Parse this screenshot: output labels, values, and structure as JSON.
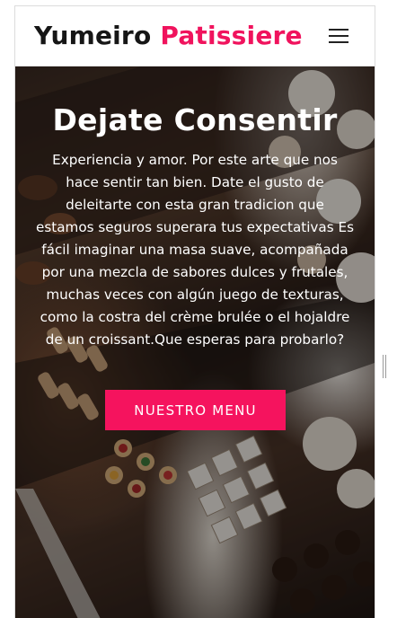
{
  "brand": {
    "part1": "Yumeiro",
    "part2": "Patissiere"
  },
  "nav": {
    "menu_icon": "hamburger-menu-icon"
  },
  "hero": {
    "title": "Dejate Consentir",
    "text": "Experiencia y amor. Por este arte que nos hace sentir tan bien. Date el gusto de deleitarte con esta gran tradicion que estamos seguros superara tus expectativas Es fácil imaginar una masa suave, acompañada por una mezcla de sabores dulces y frutales, muchas veces con algún juego de texturas, como la costra del crème brulée o el hojaldre de un croissant.Que esperas para probarlo?",
    "cta_label": "NUESTRO MENU"
  },
  "colors": {
    "accent": "#f0135d",
    "button": "#f5135e",
    "brand_dark": "#161616"
  }
}
